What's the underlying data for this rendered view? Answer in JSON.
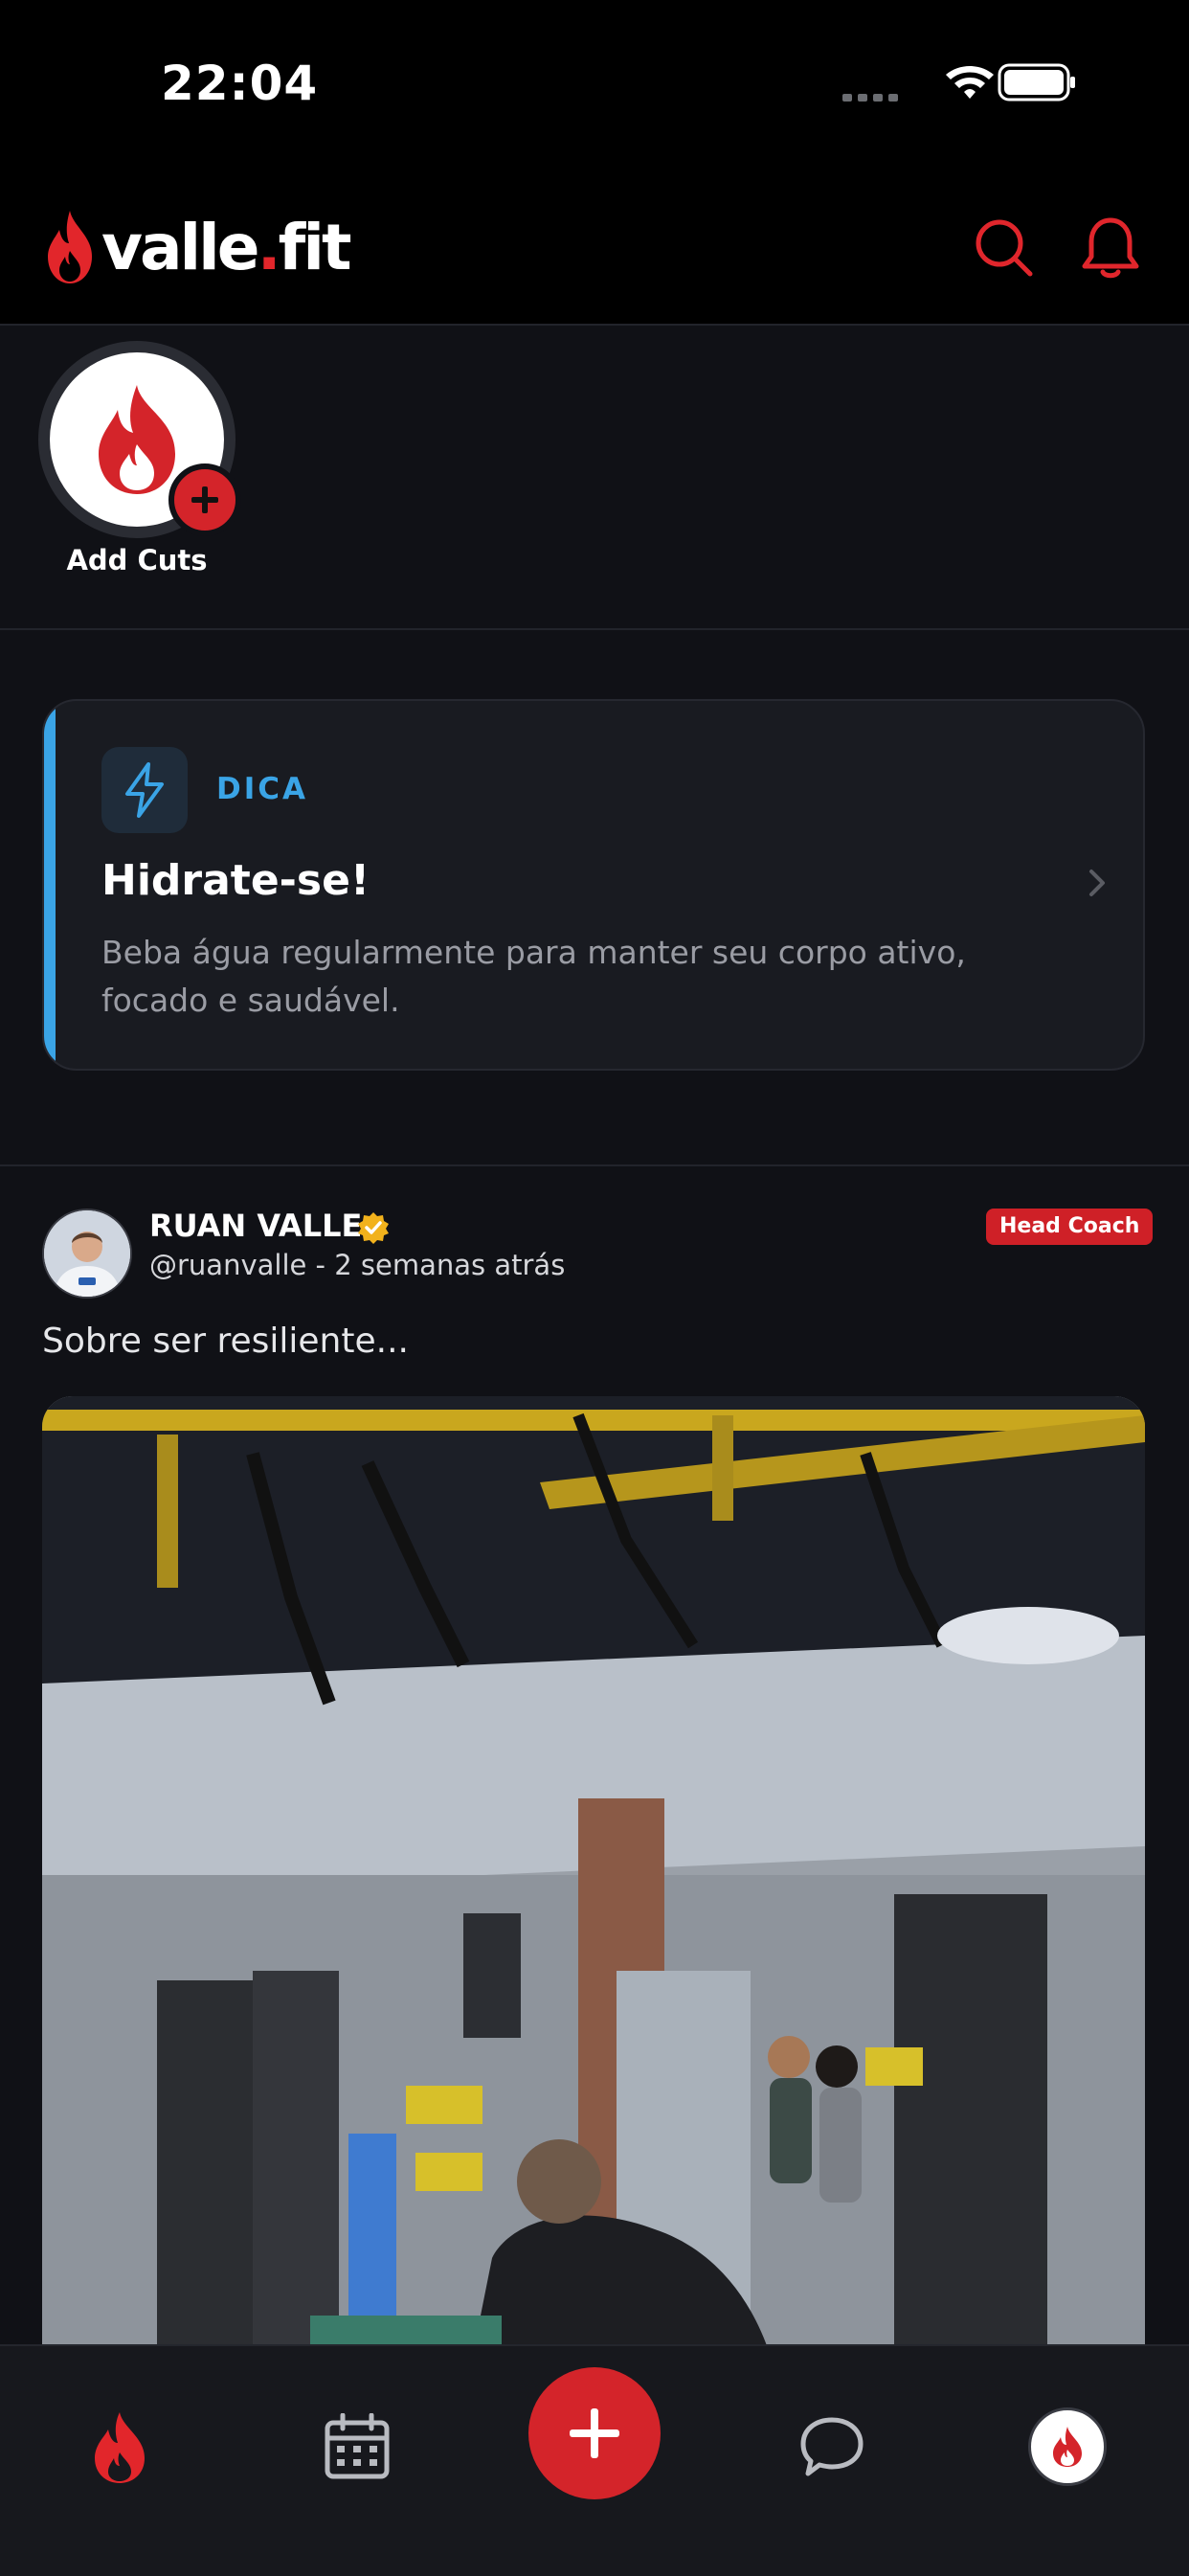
{
  "status_bar": {
    "time": "22:04"
  },
  "header": {
    "logo_main": "valle",
    "logo_dot": ".",
    "logo_suffix": "fit"
  },
  "cuts": {
    "add_label": "Add Cuts"
  },
  "tip": {
    "tag": "DICA",
    "title": "Hidrate-se!",
    "body": "Beba água regularmente para manter seu corpo ativo, focado e saudável."
  },
  "post": {
    "author_name": "RUAN VALLE",
    "author_meta": "@ruanvalle - 2 semanas atrás",
    "badge": "Head Coach",
    "text": "Sobre ser resiliente..."
  },
  "colors": {
    "brand_red": "#d4242a",
    "tip_accent": "#3aa4e6",
    "background": "#101116"
  },
  "icons": {
    "header": [
      "search-icon",
      "bell-icon"
    ],
    "tabs": [
      "flame-icon",
      "calendar-icon",
      "plus-icon",
      "chat-bubble-icon",
      "profile-flame-icon"
    ]
  }
}
